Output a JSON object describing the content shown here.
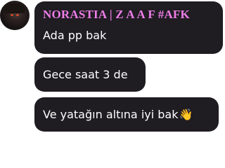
{
  "avatar": {
    "icon": "profile-avatar-dark"
  },
  "messages": [
    {
      "sender": "NORASTIA | Z A A F #AFK",
      "text": "Ada pp bak"
    },
    {
      "text": "Gece saat 3 de"
    },
    {
      "text": "Ve yatağın altına iyi bak",
      "emoji": "👋"
    }
  ],
  "colors": {
    "bubble": "#1f1c22",
    "sender_name": "#ee7ee8",
    "message_text": "#ffffff",
    "background": "#ffffff"
  }
}
